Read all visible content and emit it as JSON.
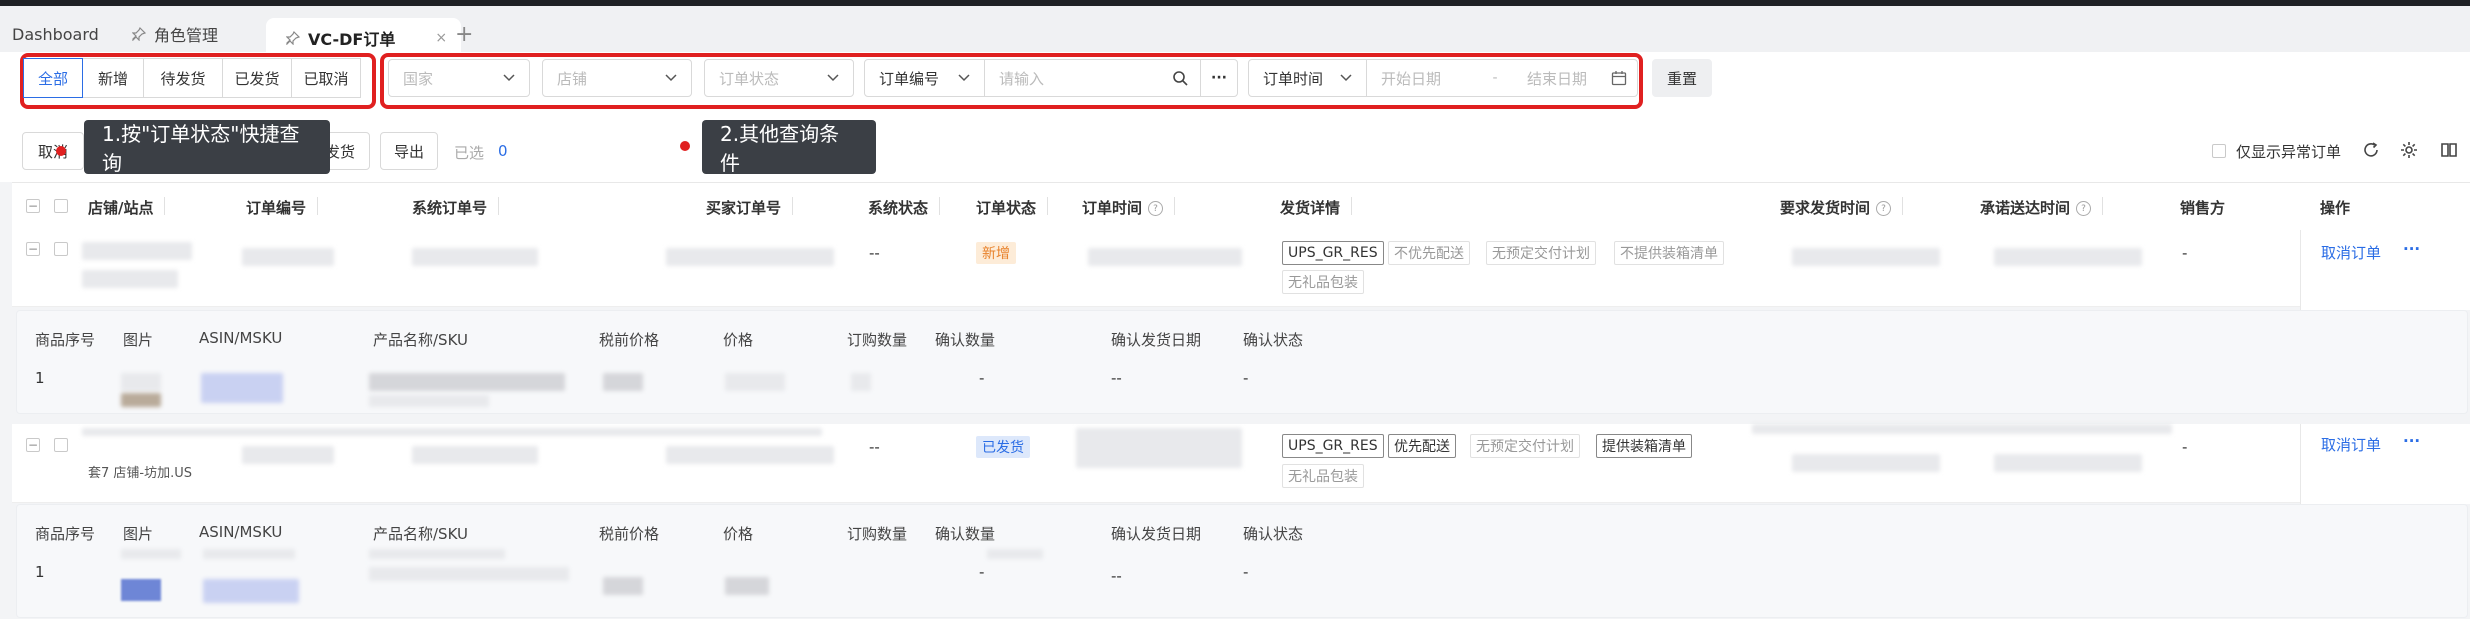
{
  "tabs": {
    "dashboard": "Dashboard",
    "role_mgmt": "角色管理",
    "vcdf_orders": "VC-DF订单",
    "close": "×",
    "add": "+"
  },
  "status_tabs": [
    "全部",
    "新增",
    "待发货",
    "已发货",
    "已取消"
  ],
  "filters": {
    "country": "国家",
    "store": "店铺",
    "order_status": "订单状态",
    "order_no_type": "订单编号",
    "search_placeholder": "请输入",
    "more": "···",
    "time_type": "订单时间",
    "start_date": "开始日期",
    "date_sep": "-",
    "end_date": "结束日期",
    "reset": "重置"
  },
  "tooltips": {
    "tip1": "1.按\"订单状态\"快捷查询",
    "tip2": "2.其他查询条件"
  },
  "actions": {
    "cancel_partial": "取消",
    "ship_partial": "发货",
    "export": "导出",
    "selected_label": "已选",
    "selected_count": "0",
    "only_abnormal": "仅显示异常订单"
  },
  "columns": {
    "store_site": "店铺/站点",
    "order_no": "订单编号",
    "system_order_no": "系统订单号",
    "buyer_order_no": "买家订单号",
    "system_status": "系统状态",
    "order_status": "订单状态",
    "order_time": "订单时间",
    "ship_detail": "发货详情",
    "required_ship_time": "要求发货时间",
    "promised_delivery_time": "承诺送达时间",
    "seller": "销售方",
    "operation": "操作"
  },
  "sub_columns": {
    "item_no": "商品序号",
    "image": "图片",
    "asin_msku": "ASIN/MSKU",
    "product_sku": "产品名称/SKU",
    "pretax_price": "税前价格",
    "price": "价格",
    "order_qty": "订购数量",
    "confirm_qty": "确认数量",
    "confirm_ship_date": "确认发货日期",
    "confirm_status": "确认状态"
  },
  "orders": [
    {
      "system_status": "--",
      "status": "新增",
      "tags": [
        "UPS_GR_RES",
        "不优先配送",
        "无预定交付计划",
        "不提供装箱清单",
        "无礼品包装"
      ],
      "seller": "-",
      "action": "取消订单",
      "more": "···",
      "item": {
        "no": "1",
        "confirm_qty": "-",
        "confirm_date": "--",
        "confirm_status": "-"
      }
    },
    {
      "store_text": "套7 店铺-坊加.US",
      "system_status": "--",
      "status": "已发货",
      "tags": [
        "UPS_GR_RES",
        "优先配送",
        "无预定交付计划",
        "提供装箱清单",
        "无礼品包装"
      ],
      "seller": "-",
      "action": "取消订单",
      "more": "···",
      "item": {
        "no": "1",
        "confirm_qty": "-",
        "confirm_date": "--",
        "confirm_status": "-"
      }
    }
  ],
  "colors": {
    "accent": "#2b6de5",
    "highlight_red": "#e02020",
    "status_new_bg": "#fdecd8",
    "status_new_fg": "#e8822c",
    "status_shipped_bg": "#dde8fb",
    "status_shipped_fg": "#2b6de5"
  }
}
